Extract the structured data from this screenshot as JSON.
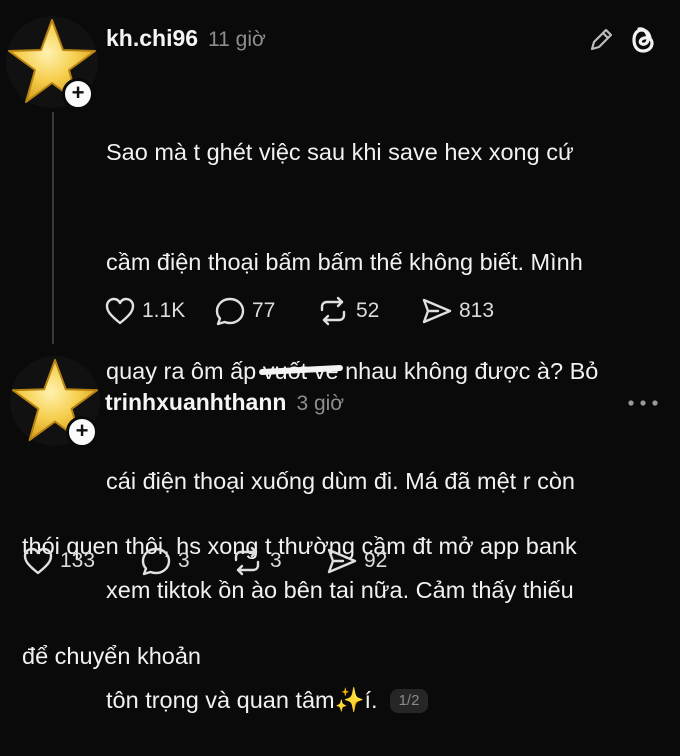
{
  "post1": {
    "username": "kh.chi96",
    "time": "11 giờ",
    "text_lines": [
      "Sao mà t ghét việc sau khi save hex xong cứ",
      "cầm điện thoại bấm bấm thế không biết. Mình"
    ],
    "line3_before": "quay ra ôm ấp ",
    "line3_struck": "vuốt ve",
    "line3_after": " nhau không được à? Bỏ",
    "text_lines2": [
      "cái điện thoại xuống dùm đi. Má đã mệt r còn",
      "xem tiktok ồn ào bên tai nữa. Cảm thấy thiếu"
    ],
    "last_line_text": "tôn trọng và quan tâm",
    "sparkle": "✨",
    "last_line_tail": "í.",
    "page_indicator": "1/2",
    "likes": "1.1K",
    "comments": "77",
    "reposts": "52",
    "shares": "813"
  },
  "post2": {
    "username": "trinhxuanhthann",
    "time": "3 giờ",
    "text_lines": [
      "thói quen thôi, hs xong t thường cầm đt mở app bank",
      "để chuyển khoản"
    ],
    "likes": "133",
    "comments": "3",
    "reposts": "3",
    "shares": "92"
  },
  "icons": {
    "edit": "pencil-icon",
    "app": "threads-logo-icon",
    "more": "more-dots-icon",
    "like": "heart-icon",
    "comment": "comment-icon",
    "repost": "repost-icon",
    "share": "share-icon",
    "avatar": "star-avatar"
  },
  "colors": {
    "background": "#0a0a0a",
    "text": "#f3f3f3",
    "muted": "#8e8e8e",
    "star": "#f2c641"
  }
}
